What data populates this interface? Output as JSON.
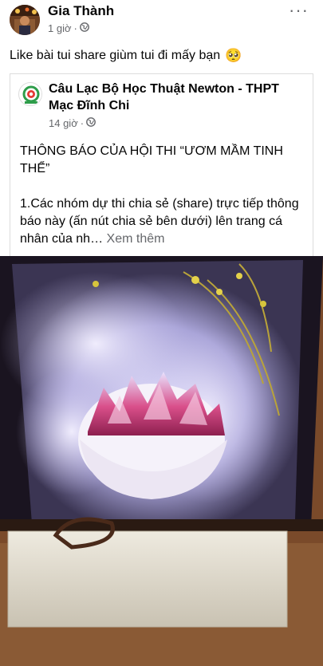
{
  "post": {
    "author": "Gia Thành",
    "time": "1 giờ",
    "separator": "·",
    "text": "Like bài tui share giùm tui đi mấy bạn",
    "emoji": "🥺",
    "more_label": "···"
  },
  "shared": {
    "page_name": "Câu Lạc Bộ Học Thuật Newton - THPT Mạc Đĩnh Chi",
    "time": "14 giờ",
    "separator": "·",
    "paragraph1": "THÔNG BÁO CỦA HỘI THI “ƯƠM MẦM TINH THỂ”",
    "paragraph2": "1.Các nhóm dự thi chia sẻ (share) trực tiếp thông báo này (ấn nút chia sẻ bên dưới) lên trang cá nhân của nh…",
    "see_more": "Xem thêm"
  },
  "icons": {
    "privacy": "globe-icon",
    "more": "more-options-icon"
  },
  "colors": {
    "text": "#050505",
    "secondary": "#65676b",
    "crystal": "#d94f8a"
  }
}
